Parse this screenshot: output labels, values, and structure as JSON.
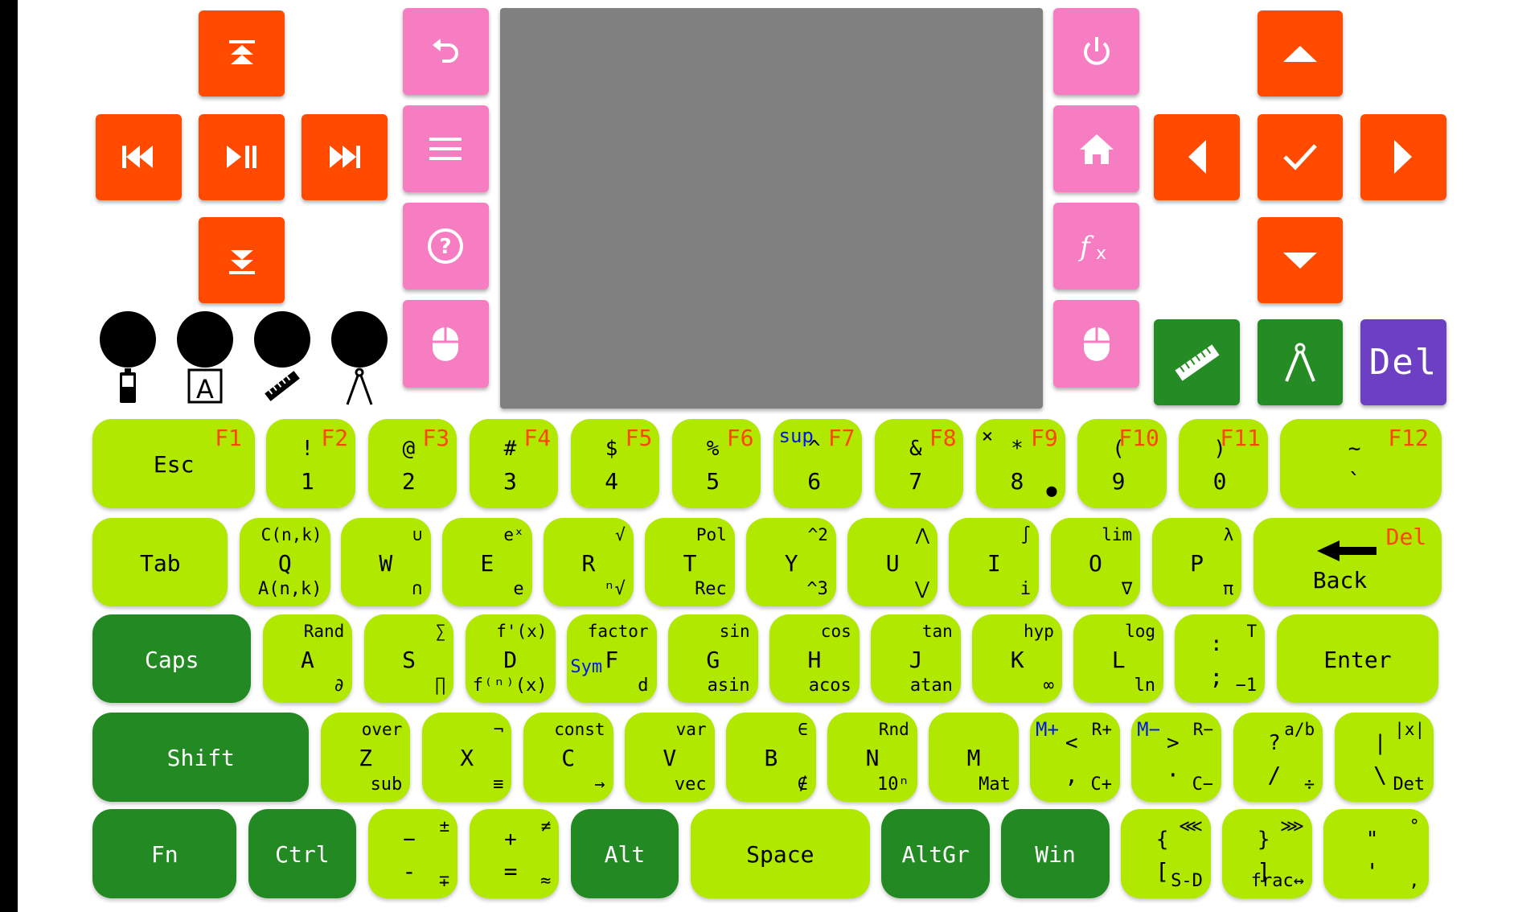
{
  "purple_button": {
    "label": "Del"
  },
  "colors": {
    "orange": "#ff4a00",
    "pink": "#f77dc3",
    "lime": "#b0e800",
    "dark_green": "#238a23",
    "purple": "#6c3fc3",
    "screen": "#808080",
    "fn_red": "#ff4500",
    "blue": "#0018e8"
  },
  "keyboard": {
    "rows": [
      [
        {
          "main": "Esc",
          "fn": "F1"
        },
        {
          "top": "!",
          "main": "1",
          "fn": "F2"
        },
        {
          "top": "@",
          "main": "2",
          "fn": "F3"
        },
        {
          "top": "#",
          "main": "3",
          "fn": "F4"
        },
        {
          "top": "$",
          "main": "4",
          "fn": "F5"
        },
        {
          "top": "%",
          "main": "5",
          "fn": "F6"
        },
        {
          "tl": "sup",
          "top": "^",
          "main": "6",
          "fn": "F7"
        },
        {
          "top": "&",
          "main": "7",
          "fn": "F8"
        },
        {
          "tlb": "×",
          "top": "*",
          "main": "8",
          "br": "●",
          "fn": "F9"
        },
        {
          "top": "(",
          "main": "9",
          "fn": "F10"
        },
        {
          "top": ")",
          "main": "0",
          "fn": "F11"
        },
        {
          "top": "~",
          "main": "`",
          "fn": "F12"
        }
      ],
      [
        {
          "main": "Tab"
        },
        {
          "main": "Q",
          "tr": "C(n,k)",
          "br": "A(n,k)"
        },
        {
          "main": "W",
          "tr": "∪",
          "br": "∩"
        },
        {
          "main": "E",
          "tr": "eˣ",
          "br": "e"
        },
        {
          "main": "R",
          "tr": "√",
          "br": "ⁿ√"
        },
        {
          "main": "T",
          "tr": "Pol",
          "br": "Rec"
        },
        {
          "main": "Y",
          "tr": "^2",
          "br": "^3"
        },
        {
          "main": "U",
          "tr": "⋀",
          "br": "⋁"
        },
        {
          "main": "I",
          "tr": "∫",
          "br": "i"
        },
        {
          "main": "O",
          "tr": "lim",
          "br": "∇"
        },
        {
          "main": "P",
          "tr": "λ",
          "br": "π"
        },
        {
          "main": "Back",
          "fn": "Del"
        }
      ],
      [
        {
          "main": "Caps"
        },
        {
          "main": "A",
          "tr": "Rand",
          "br": "∂"
        },
        {
          "main": "S",
          "tr": "∑",
          "br": "∏"
        },
        {
          "main": "D",
          "tr": "f'(x)",
          "br": "f⁽ⁿ⁾(x)"
        },
        {
          "mid": "Sym",
          "main": "F",
          "tr": "factor",
          "br": "d"
        },
        {
          "main": "G",
          "tr": "sin",
          "br": "asin"
        },
        {
          "main": "H",
          "tr": "cos",
          "br": "acos"
        },
        {
          "main": "J",
          "tr": "tan",
          "br": "atan"
        },
        {
          "main": "K",
          "tr": "hyp",
          "br": "∞"
        },
        {
          "main": "L",
          "tr": "log",
          "br": "ln"
        },
        {
          "top": ":",
          "main": ";",
          "tr": "T",
          "br": "−1"
        },
        {
          "main": "Enter"
        }
      ],
      [
        {
          "main": "Shift"
        },
        {
          "main": "Z",
          "tr": "over",
          "br": "sub"
        },
        {
          "main": "X",
          "tr": "¬",
          "br": "≡"
        },
        {
          "main": "C",
          "tr": "const",
          "br": "→"
        },
        {
          "main": "V",
          "tr": "var",
          "br": "vec"
        },
        {
          "main": "B",
          "tr": "∈",
          "br": "∉"
        },
        {
          "main": "N",
          "tr": "Rnd",
          "br": "10ⁿ"
        },
        {
          "main": "M",
          "br": "Mat"
        },
        {
          "tl": "M+",
          "top": "<",
          "main": ",",
          "tr": "R+",
          "br": "C+"
        },
        {
          "tl": "M−",
          "top": ">",
          "main": "·",
          "tr": "R−",
          "br": "C−"
        },
        {
          "top": "?",
          "main": "/",
          "tr": "a/b",
          "br": "÷"
        },
        {
          "top": "|",
          "main": "\\",
          "tr": "|x|",
          "br": "Det"
        }
      ],
      [
        {
          "main": "Fn"
        },
        {
          "main": "Ctrl"
        },
        {
          "top": "−",
          "main": "-",
          "tr": "±",
          "br": "∓"
        },
        {
          "top": "+",
          "main": "=",
          "tr": "≠",
          "br": "≈"
        },
        {
          "main": "Alt"
        },
        {
          "main": "Space"
        },
        {
          "main": "AltGr"
        },
        {
          "main": "Win"
        },
        {
          "top": "{",
          "main": "[",
          "tr": "⋘",
          "br": "S-D"
        },
        {
          "top": "}",
          "main": "]",
          "tr": "⋙",
          "br": "frac↔"
        },
        {
          "top": "\"",
          "main": "'",
          "tr": "°",
          "br": ","
        }
      ]
    ]
  }
}
